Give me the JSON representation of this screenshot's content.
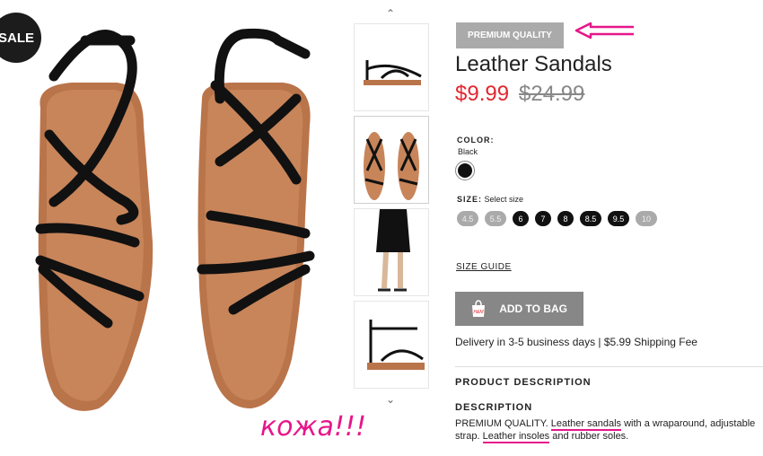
{
  "sale_badge": "SALE",
  "thumbnails": {
    "up_arrow": "⌃",
    "down_arrow": "⌄",
    "items": [
      "sandal-side",
      "sandal-top",
      "model-legs",
      "sandal-side-2"
    ]
  },
  "product": {
    "quality_badge": "PREMIUM QUALITY",
    "title": "Leather Sandals",
    "price_sale": "$9.99",
    "price_old": "$24.99",
    "price_sale_color": "#e3262f"
  },
  "color": {
    "label": "COLOR:",
    "selected": "Black",
    "swatch_hex": "#111111"
  },
  "size": {
    "label": "SIZE:",
    "hint": "Select size",
    "options": [
      {
        "label": "4.5",
        "available": false
      },
      {
        "label": "5.5",
        "available": false
      },
      {
        "label": "6",
        "available": true
      },
      {
        "label": "7",
        "available": true
      },
      {
        "label": "8",
        "available": true
      },
      {
        "label": "8.5",
        "available": true
      },
      {
        "label": "9.5",
        "available": true
      },
      {
        "label": "10",
        "available": false
      }
    ]
  },
  "size_guide": "SIZE GUIDE",
  "add_to_bag": "ADD TO BAG",
  "bag_icon_text": "H&M",
  "delivery": "Delivery in 3-5 business days | $5.99 Shipping Fee",
  "product_description_heading": "PRODUCT DESCRIPTION",
  "description_label": "DESCRIPTION",
  "description_parts": {
    "p1": "PREMIUM QUALITY. ",
    "p2": "Leather sandals",
    "p3": " with a wraparound, adjustable",
    "p4": "strap. ",
    "p5": "Leather insoles",
    "p6": " and rubber soles."
  },
  "annotation": {
    "handwritten": "кожа!!!",
    "color": "#e6168a"
  }
}
